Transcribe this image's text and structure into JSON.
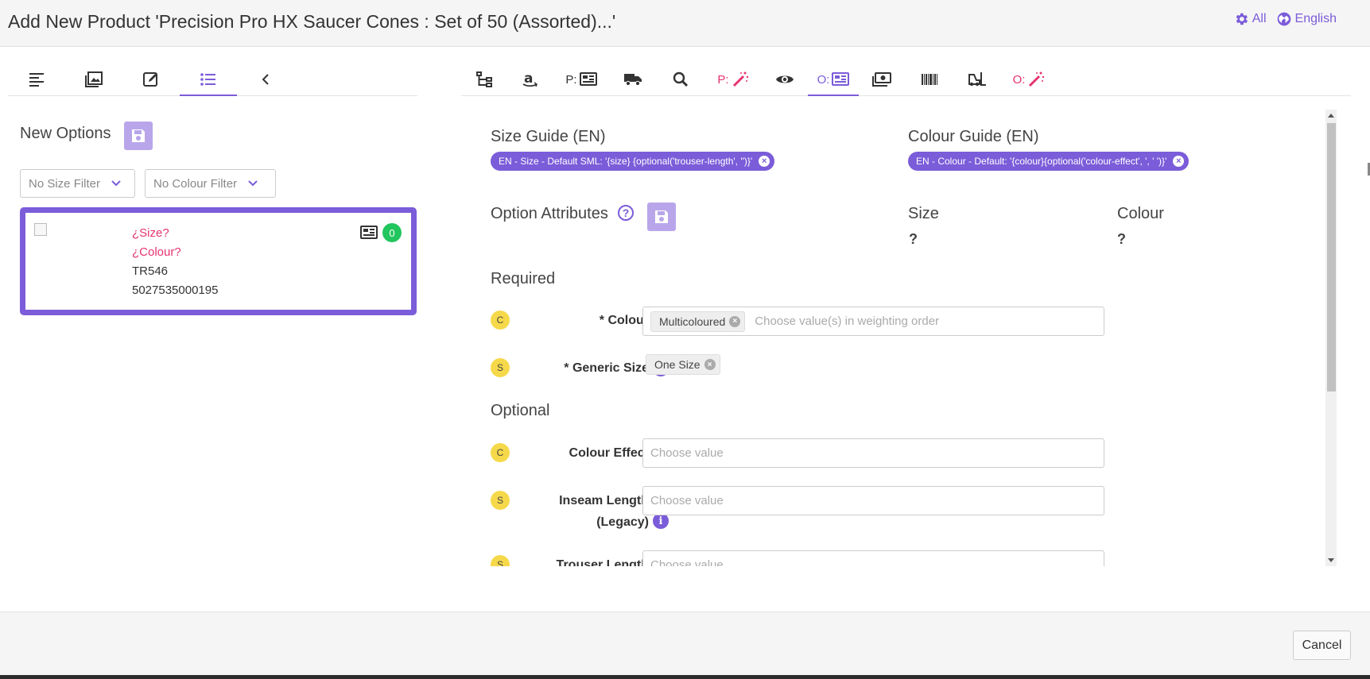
{
  "header": {
    "title": "Add New Product 'Precision Pro HX Saucer Cones : Set of 50 (Assorted)...'",
    "settings_label": "All",
    "language_label": "English"
  },
  "left_tabs": [
    {
      "icon": "align-left-icon",
      "active": false
    },
    {
      "icon": "images-icon",
      "active": false
    },
    {
      "icon": "edit-icon",
      "active": false
    },
    {
      "icon": "list-icon",
      "active": true
    },
    {
      "icon": "chevron-left-icon",
      "active": false
    }
  ],
  "right_tabs": {
    "p_prefix": "P:",
    "o_prefix": "O:"
  },
  "left_pane": {
    "title": "New Options",
    "size_filter": "No Size Filter",
    "colour_filter": "No Colour Filter",
    "card": {
      "size": "¿Size?",
      "colour": "¿Colour?",
      "code": "TR546",
      "barcode": "5027535000195",
      "badge": "0"
    }
  },
  "right_pane": {
    "size_guide_label": "Size Guide (EN)",
    "size_guide_chip": "EN - Size - Default SML: '{size} {optional('trouser-length', '')}'",
    "colour_guide_label": "Colour Guide (EN)",
    "colour_guide_chip": "EN - Colour - Default: '{colour}{optional('colour-effect', ', ' ')}'",
    "option_attributes_label": "Option Attributes",
    "size_header": "Size",
    "colour_header": "Colour",
    "size_value": "?",
    "colour_value": "?",
    "required_label": "Required",
    "optional_label": "Optional",
    "fields": {
      "colour": {
        "letter": "C",
        "label": "* Colour",
        "tag": "Multicoloured",
        "placeholder": "Choose value(s) in weighting order"
      },
      "generic_size": {
        "letter": "S",
        "label": "* Generic Size",
        "tag": "One Size"
      },
      "colour_effect": {
        "letter": "C",
        "label": "Colour Effect",
        "placeholder": "Choose value"
      },
      "inseam_length": {
        "letter": "S",
        "label_line1": "Inseam Length",
        "label_line2": "(Legacy)",
        "placeholder": "Choose value"
      },
      "trouser_length": {
        "letter": "S",
        "label": "Trouser Length",
        "placeholder": "Choose value"
      }
    }
  },
  "footer": {
    "cancel_label": "Cancel"
  },
  "colors": {
    "accent": "#7b5cd9",
    "accent_light": "#b9a6ea",
    "warning": "#e6336e",
    "success": "#22c55e",
    "attribute_circle": "#f6d94a"
  }
}
